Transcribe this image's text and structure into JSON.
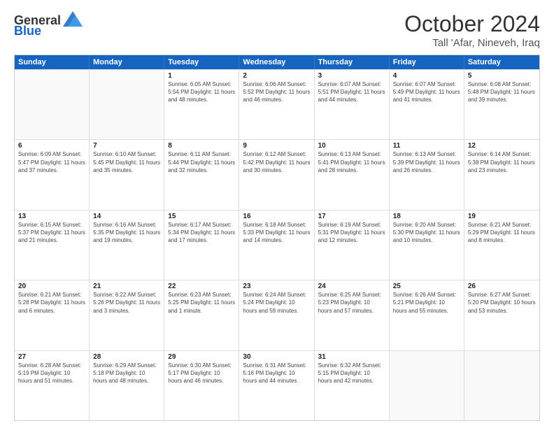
{
  "logo": {
    "general": "General",
    "blue": "Blue"
  },
  "header": {
    "title": "October 2024",
    "subtitle": "Tall 'Afar, Nineveh, Iraq"
  },
  "calendar": {
    "days": [
      "Sunday",
      "Monday",
      "Tuesday",
      "Wednesday",
      "Thursday",
      "Friday",
      "Saturday"
    ],
    "rows": [
      [
        {
          "day": "",
          "info": ""
        },
        {
          "day": "",
          "info": ""
        },
        {
          "day": "1",
          "info": "Sunrise: 6:05 AM\nSunset: 5:54 PM\nDaylight: 11 hours and 48 minutes."
        },
        {
          "day": "2",
          "info": "Sunrise: 6:06 AM\nSunset: 5:52 PM\nDaylight: 11 hours and 46 minutes."
        },
        {
          "day": "3",
          "info": "Sunrise: 6:07 AM\nSunset: 5:51 PM\nDaylight: 11 hours and 44 minutes."
        },
        {
          "day": "4",
          "info": "Sunrise: 6:07 AM\nSunset: 5:49 PM\nDaylight: 11 hours and 41 minutes."
        },
        {
          "day": "5",
          "info": "Sunrise: 6:08 AM\nSunset: 5:48 PM\nDaylight: 11 hours and 39 minutes."
        }
      ],
      [
        {
          "day": "6",
          "info": "Sunrise: 6:09 AM\nSunset: 5:47 PM\nDaylight: 11 hours and 37 minutes."
        },
        {
          "day": "7",
          "info": "Sunrise: 6:10 AM\nSunset: 5:45 PM\nDaylight: 11 hours and 35 minutes."
        },
        {
          "day": "8",
          "info": "Sunrise: 6:11 AM\nSunset: 5:44 PM\nDaylight: 11 hours and 32 minutes."
        },
        {
          "day": "9",
          "info": "Sunrise: 6:12 AM\nSunset: 5:42 PM\nDaylight: 11 hours and 30 minutes."
        },
        {
          "day": "10",
          "info": "Sunrise: 6:13 AM\nSunset: 5:41 PM\nDaylight: 11 hours and 28 minutes."
        },
        {
          "day": "11",
          "info": "Sunrise: 6:13 AM\nSunset: 5:39 PM\nDaylight: 11 hours and 26 minutes."
        },
        {
          "day": "12",
          "info": "Sunrise: 6:14 AM\nSunset: 5:38 PM\nDaylight: 11 hours and 23 minutes."
        }
      ],
      [
        {
          "day": "13",
          "info": "Sunrise: 6:15 AM\nSunset: 5:37 PM\nDaylight: 11 hours and 21 minutes."
        },
        {
          "day": "14",
          "info": "Sunrise: 6:16 AM\nSunset: 5:35 PM\nDaylight: 11 hours and 19 minutes."
        },
        {
          "day": "15",
          "info": "Sunrise: 6:17 AM\nSunset: 5:34 PM\nDaylight: 11 hours and 17 minutes."
        },
        {
          "day": "16",
          "info": "Sunrise: 6:18 AM\nSunset: 5:33 PM\nDaylight: 11 hours and 14 minutes."
        },
        {
          "day": "17",
          "info": "Sunrise: 6:19 AM\nSunset: 5:31 PM\nDaylight: 11 hours and 12 minutes."
        },
        {
          "day": "18",
          "info": "Sunrise: 6:20 AM\nSunset: 5:30 PM\nDaylight: 11 hours and 10 minutes."
        },
        {
          "day": "19",
          "info": "Sunrise: 6:21 AM\nSunset: 5:29 PM\nDaylight: 11 hours and 8 minutes."
        }
      ],
      [
        {
          "day": "20",
          "info": "Sunrise: 6:21 AM\nSunset: 5:28 PM\nDaylight: 11 hours and 6 minutes."
        },
        {
          "day": "21",
          "info": "Sunrise: 6:22 AM\nSunset: 5:26 PM\nDaylight: 11 hours and 3 minutes."
        },
        {
          "day": "22",
          "info": "Sunrise: 6:23 AM\nSunset: 5:25 PM\nDaylight: 11 hours and 1 minute."
        },
        {
          "day": "23",
          "info": "Sunrise: 6:24 AM\nSunset: 5:24 PM\nDaylight: 10 hours and 59 minutes."
        },
        {
          "day": "24",
          "info": "Sunrise: 6:25 AM\nSunset: 5:23 PM\nDaylight: 10 hours and 57 minutes."
        },
        {
          "day": "25",
          "info": "Sunrise: 6:26 AM\nSunset: 5:21 PM\nDaylight: 10 hours and 55 minutes."
        },
        {
          "day": "26",
          "info": "Sunrise: 6:27 AM\nSunset: 5:20 PM\nDaylight: 10 hours and 53 minutes."
        }
      ],
      [
        {
          "day": "27",
          "info": "Sunrise: 6:28 AM\nSunset: 5:19 PM\nDaylight: 10 hours and 51 minutes."
        },
        {
          "day": "28",
          "info": "Sunrise: 6:29 AM\nSunset: 5:18 PM\nDaylight: 10 hours and 48 minutes."
        },
        {
          "day": "29",
          "info": "Sunrise: 6:30 AM\nSunset: 5:17 PM\nDaylight: 10 hours and 46 minutes."
        },
        {
          "day": "30",
          "info": "Sunrise: 6:31 AM\nSunset: 5:16 PM\nDaylight: 10 hours and 44 minutes."
        },
        {
          "day": "31",
          "info": "Sunrise: 6:32 AM\nSunset: 5:15 PM\nDaylight: 10 hours and 42 minutes."
        },
        {
          "day": "",
          "info": ""
        },
        {
          "day": "",
          "info": ""
        }
      ]
    ]
  }
}
